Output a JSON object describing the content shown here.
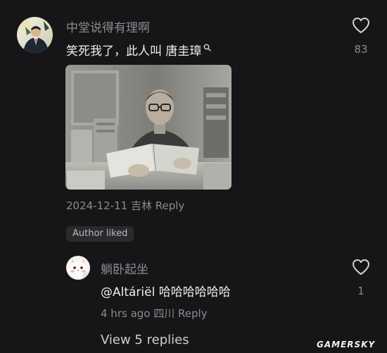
{
  "comment": {
    "username": "中堂说得有理啊",
    "text": "笑死我了，此人叫 唐圭璋",
    "search_icon": "search-icon",
    "like_count": "83",
    "date": "2024-12-11",
    "location": "吉林",
    "reply_label": "Reply",
    "author_liked": "Author liked",
    "photo_alt": "Black and white photo of an elderly man in glasses reading at a desk stacked with books"
  },
  "reply": {
    "username": "躺卧起坐",
    "mention": "@Altáriël",
    "text": "哈哈哈哈哈哈",
    "like_count": "1",
    "time": "4 hrs ago",
    "location": "四川",
    "reply_label": "Reply"
  },
  "view_replies": "View 5 replies",
  "watermark": "GAMERSKY",
  "colors": {
    "background": "#161618",
    "text": "#ededed",
    "muted": "#8c8c90",
    "badge_bg": "#2a2a2d"
  }
}
